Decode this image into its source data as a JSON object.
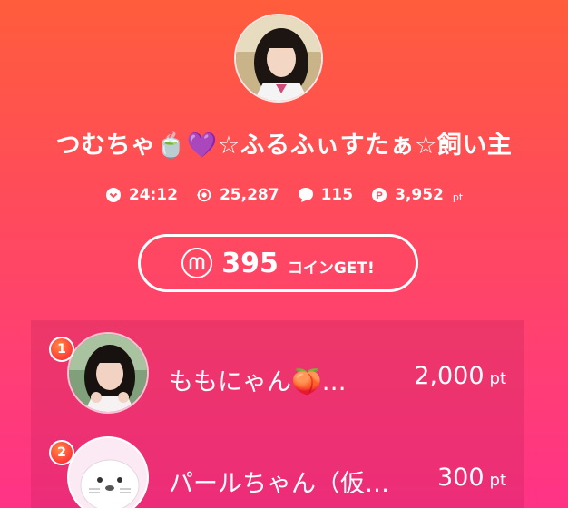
{
  "profile": {
    "avatar": "girl-portrait",
    "title": "つむちゃ🍵💜☆ふるふぃすたぁ☆飼い主"
  },
  "stats": [
    {
      "icon": "clock-icon",
      "value": "24:12"
    },
    {
      "icon": "viewers-icon",
      "value": "25,287"
    },
    {
      "icon": "comment-icon",
      "value": "115"
    },
    {
      "icon": "points-icon",
      "value": "3,952",
      "unit": "pt"
    }
  ],
  "coin_button": {
    "amount": "395",
    "label": "コインGET!"
  },
  "ranking": [
    {
      "rank": "1",
      "name": "ももにゃん🍑…",
      "points": "2,000",
      "unit": "pt",
      "avatar": "girl-portrait"
    },
    {
      "rank": "2",
      "name": "パールちゃん（仮…",
      "points": "300",
      "unit": "pt",
      "avatar": "seal-mascot"
    }
  ],
  "colors": {
    "bg_top": "#ff5d3c",
    "bg_bottom": "#ff3386",
    "rank_badge": "#ff4a3a"
  }
}
